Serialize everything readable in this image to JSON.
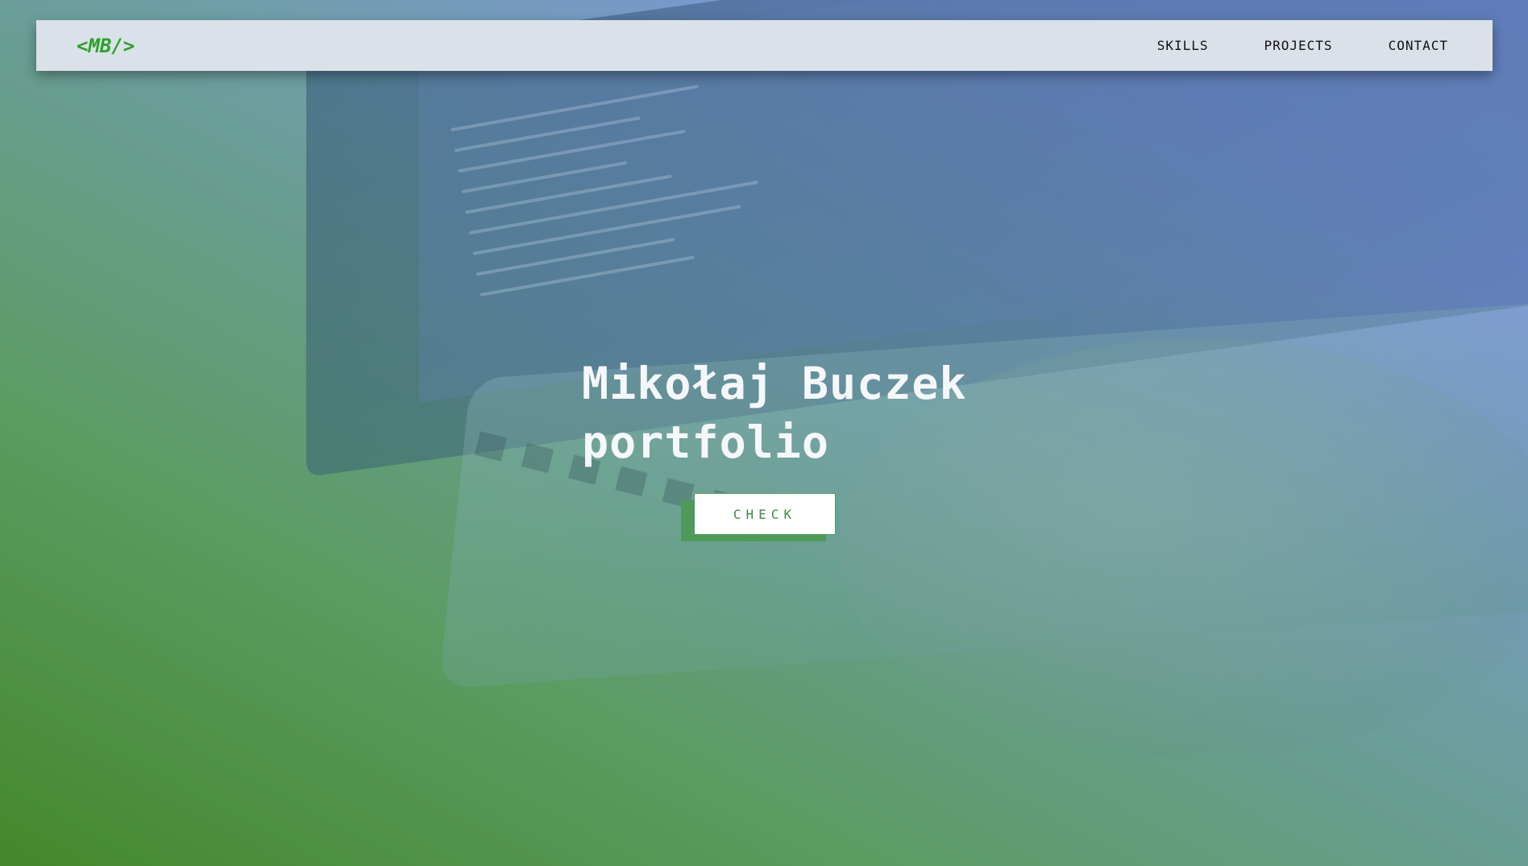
{
  "navbar": {
    "logo": "<MB/>",
    "links": [
      {
        "label": "SKILLS"
      },
      {
        "label": "PROJECTS"
      },
      {
        "label": "CONTACT"
      }
    ]
  },
  "hero": {
    "title_line1": "Mikołaj Buczek",
    "title_line2": "portfolio",
    "cta_label": "CHECK"
  },
  "colors": {
    "logo": "#2ea02a",
    "navbar_bg": "#dae1e8",
    "cta_text": "#3d8a45",
    "cta_shadow": "#4f9a5a"
  }
}
